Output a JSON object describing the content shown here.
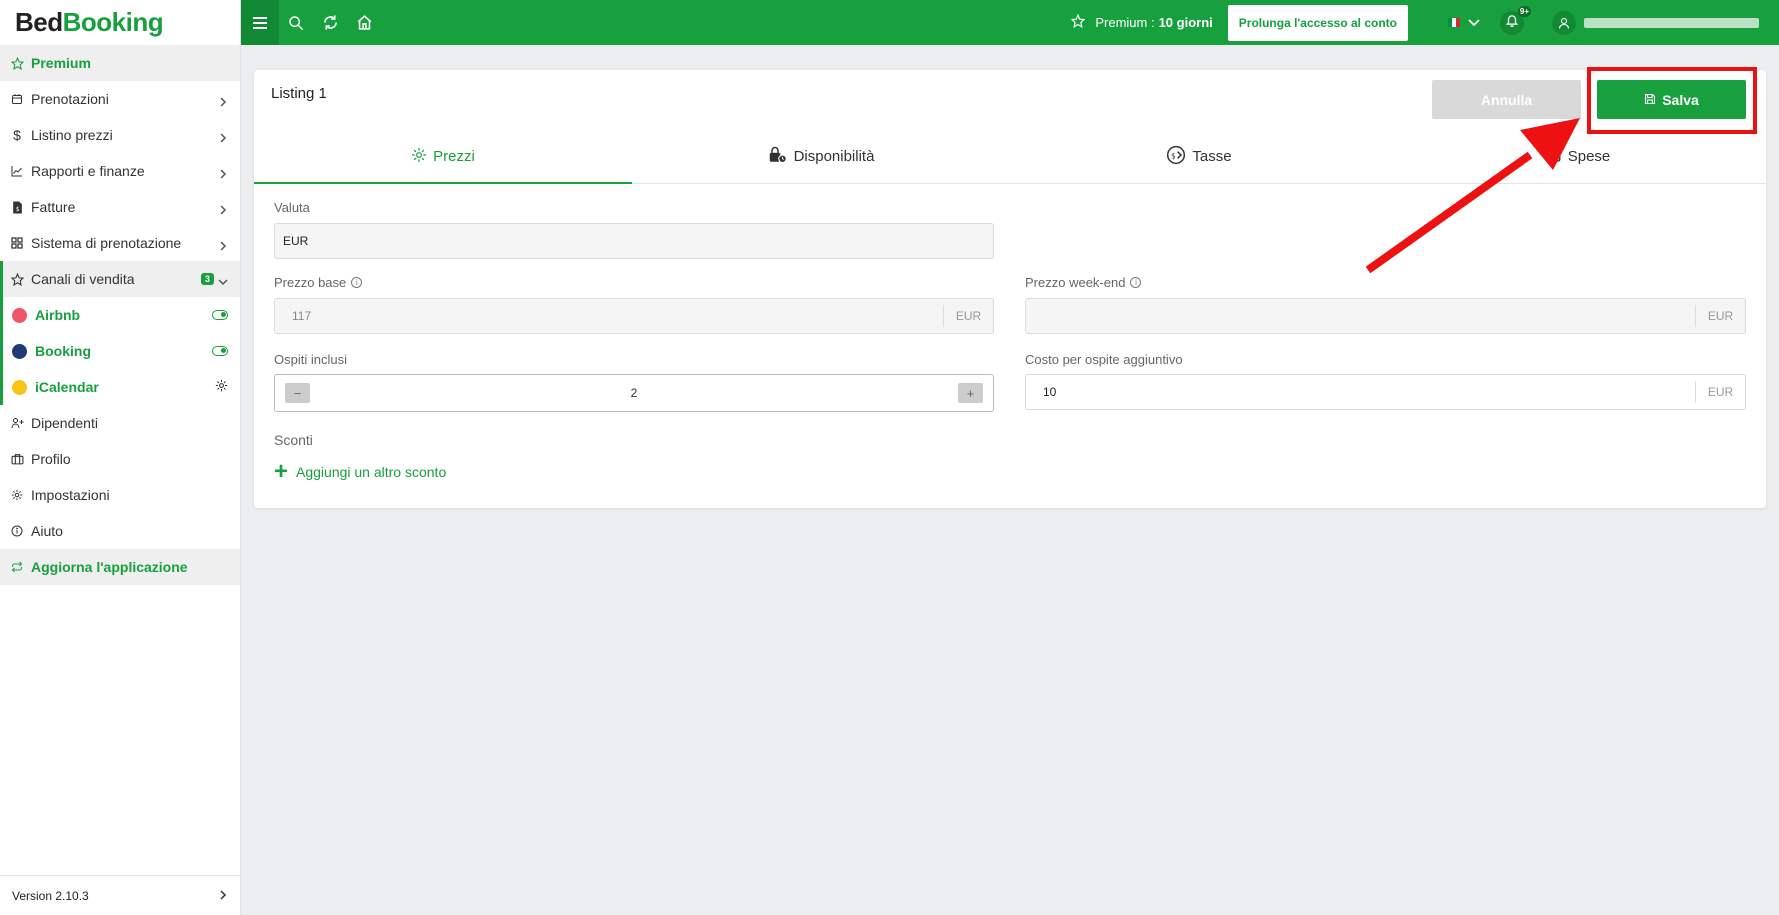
{
  "brand": {
    "part1": "Bed",
    "part2": "Booking"
  },
  "sidebar": {
    "items": [
      {
        "label": "Premium",
        "icon": "star-icon"
      },
      {
        "label": "Prenotazioni",
        "icon": "calendar-icon"
      },
      {
        "label": "Listino prezzi",
        "icon": "dollar-icon"
      },
      {
        "label": "Rapporti e finanze",
        "icon": "chart-icon"
      },
      {
        "label": "Fatture",
        "icon": "invoice-icon"
      },
      {
        "label": "Sistema di prenotazione",
        "icon": "grid-icon"
      },
      {
        "label": "Canali di vendita",
        "icon": "star-icon",
        "badge": "3"
      },
      {
        "label": "Airbnb",
        "color": "#f0556a"
      },
      {
        "label": "Booking",
        "color": "#1e3a78"
      },
      {
        "label": "iCalendar",
        "color": "#f5c518"
      },
      {
        "label": "Dipendenti",
        "icon": "user-add-icon"
      },
      {
        "label": "Profilo",
        "icon": "briefcase-icon"
      },
      {
        "label": "Impostazioni",
        "icon": "gear-icon"
      },
      {
        "label": "Aiuto",
        "icon": "info-icon"
      },
      {
        "label": "Aggiorna l'applicazione",
        "icon": "refresh-icon"
      }
    ],
    "version": "Version 2.10.3"
  },
  "topbar": {
    "premium_label": "Premium :",
    "premium_days": "10 giorni",
    "extend_label": "Prolunga l'accesso al conto",
    "notifications": "9+"
  },
  "card": {
    "title": "Listing 1",
    "cancel_label": "Annulla",
    "save_label": "Salva",
    "tabs": [
      "Prezzi",
      "Disponibilità",
      "Tasse",
      "Spese"
    ],
    "fields": {
      "currency_label": "Valuta",
      "currency_value": "EUR",
      "base_price_label": "Prezzo base",
      "base_price_value": "117",
      "base_price_unit": "EUR",
      "weekend_price_label": "Prezzo week-end",
      "weekend_price_value": "",
      "weekend_price_unit": "EUR",
      "guests_label": "Ospiti inclusi",
      "guests_value": "2",
      "extra_cost_label": "Costo per ospite aggiuntivo",
      "extra_cost_value": "10",
      "extra_cost_unit": "EUR",
      "discounts_label": "Sconti",
      "add_discount_label": "Aggiungi un altro sconto"
    }
  },
  "colors": {
    "accent": "#17a03d",
    "annotation": "#ee1111"
  }
}
